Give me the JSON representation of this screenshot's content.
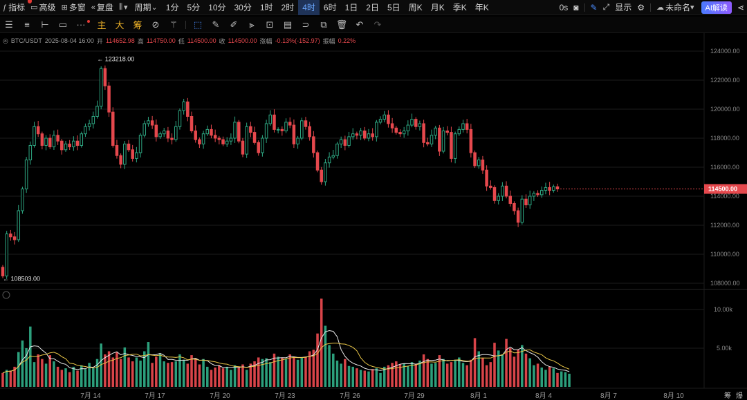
{
  "topbar": {
    "indicators": "指标",
    "advanced": "高级",
    "multi": "多窗",
    "replay": "复盘",
    "period": "周期",
    "periods": [
      "1分",
      "5分",
      "10分",
      "30分",
      "1时",
      "2时",
      "4时",
      "6时",
      "1日",
      "2日",
      "5日",
      "周K",
      "月K",
      "季K",
      "年K"
    ],
    "active_period": "4时",
    "countdown": "0s",
    "display": "显示",
    "unnamed": "未命名",
    "ai": "AI解读"
  },
  "toolbar": {
    "main": "主",
    "big": "大",
    "chip": "筹"
  },
  "info": {
    "symbol": "BTC/USDT",
    "datetime": "2025-08-04 16:00",
    "open_label": "开",
    "open": "114652.98",
    "high_label": "高",
    "high": "114750.00",
    "low_label": "低",
    "low": "114500.00",
    "close_label": "收",
    "close": "114500.00",
    "change_label": "涨幅",
    "change": "-0.13%(-152.97)",
    "amp_label": "振幅",
    "amp": "0.22%"
  },
  "colors": {
    "up": "#2ea883",
    "down": "#e5484d",
    "ma_white": "#e8e8e8",
    "ma_yellow": "#e8c547",
    "grid": "#1b1b1b"
  },
  "chart_data": {
    "type": "candlestick",
    "price_axis": {
      "min": 108000,
      "max": 124000,
      "ticks": [
        108000,
        110000,
        112000,
        114000,
        116000,
        118000,
        120000,
        122000,
        124000
      ]
    },
    "volume_axis": {
      "max_label": "10.00k",
      "mid_label": "5.00k",
      "max": 10000,
      "mid": 5000
    },
    "x_ticks": [
      "7月 14",
      "7月 17",
      "7月 20",
      "7月 23",
      "7月 26",
      "7月 29",
      "8月 1",
      "8月 4",
      "8月 7",
      "8月 10"
    ],
    "last_price": "114500.00",
    "high_marker": "123218.00",
    "low_marker": "108503.00",
    "right_tabs": [
      "筹",
      "爆"
    ],
    "closes": [
      108503,
      111400,
      111200,
      111000,
      113000,
      114500,
      116500,
      117500,
      118800,
      118300,
      117500,
      118000,
      117400,
      118200,
      117800,
      117200,
      117600,
      117400,
      117800,
      117500,
      118300,
      118800,
      119000,
      119500,
      120200,
      122800,
      121600,
      119800,
      117500,
      116800,
      116200,
      117600,
      117200,
      116600,
      117000,
      118200,
      119000,
      119200,
      118900,
      118100,
      118300,
      118500,
      118000,
      117900,
      118800,
      119900,
      120500,
      119500,
      118500,
      117900,
      117600,
      118300,
      118600,
      118200,
      118000,
      117900,
      117600,
      117800,
      118000,
      119100,
      117800,
      116900,
      118800,
      118400,
      117700,
      117000,
      118000,
      119000,
      119600,
      118600,
      118600,
      118500,
      119100,
      118900,
      117600,
      118000,
      119200,
      118800,
      118100,
      117000,
      115800,
      115000,
      116300,
      116700,
      116800,
      117600,
      117900,
      117500,
      118100,
      118300,
      118200,
      118500,
      118000,
      118300,
      118100,
      119100,
      119300,
      119600,
      119000,
      118700,
      118400,
      118300,
      118500,
      118900,
      119300,
      118800,
      119000,
      117700,
      117600,
      118200,
      118700,
      117100,
      118500,
      118400,
      116600,
      118300,
      118600,
      119000,
      118600,
      117000,
      116100,
      116500,
      115800,
      114700,
      114600,
      113700,
      114000,
      114700,
      114000,
      113500,
      113000,
      112200,
      113800,
      113400,
      114000,
      114200,
      114100,
      114400,
      114600,
      114400,
      114652,
      114500
    ],
    "volumes": [
      1800,
      2200,
      2100,
      2600,
      4500,
      6000,
      5000,
      7800,
      3200,
      4200,
      3600,
      3000,
      4100,
      3300,
      2600,
      2200,
      2400,
      1900,
      2600,
      2100,
      2800,
      2300,
      3100,
      2400,
      3600,
      5600,
      4200,
      4600,
      3800,
      4500,
      3600,
      5100,
      3800,
      3300,
      3800,
      3400,
      4600,
      5800,
      3100,
      3900,
      4300,
      3300,
      3100,
      3200,
      3300,
      4200,
      3500,
      3000,
      4100,
      3700,
      2900,
      3600,
      2600,
      2200,
      2500,
      2800,
      2400,
      2600,
      2200,
      2800,
      2500,
      2900,
      2200,
      3000,
      3300,
      3800,
      3600,
      3700,
      3200,
      4300,
      3900,
      3800,
      3600,
      4200,
      3900,
      3500,
      3800,
      3900,
      4600,
      4800,
      6900,
      11400,
      7900,
      5400,
      4300,
      3400,
      3000,
      3600,
      2700,
      2600,
      2400,
      2200,
      2100,
      2000,
      2300,
      2400,
      1800,
      2600,
      2800,
      3100,
      3300,
      2900,
      3000,
      2700,
      3200,
      2900,
      3400,
      4200,
      3600,
      3000,
      3100,
      4100,
      3600,
      3000,
      3200,
      3400,
      3800,
      3100,
      2800,
      3500,
      6300,
      4600,
      3700,
      2800,
      3200,
      5700,
      4700,
      4200,
      6200,
      5000,
      3900,
      4800,
      5400,
      4300,
      3700,
      2800,
      3000,
      2500,
      2200,
      2600,
      2400,
      1800,
      2000,
      1900,
      1700
    ]
  }
}
